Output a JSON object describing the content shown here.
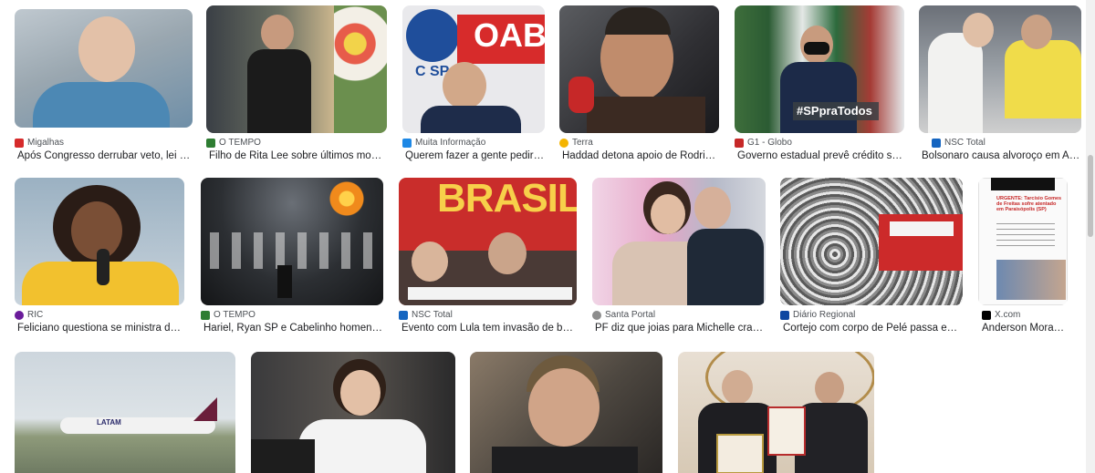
{
  "results": [
    {
      "source": "Migalhas",
      "title": "Após Congresso derrubar veto, lei P...",
      "fav_color": "#d62b2b"
    },
    {
      "source": "O TEMPO",
      "title": "Filho de Rita Lee sobre últimos mom...",
      "fav_color": "#2e7d32"
    },
    {
      "source": "Muita Informação",
      "title": "Querem fazer a gente pedir ...",
      "fav_color": "#1e88e5"
    },
    {
      "source": "Terra",
      "title": "Haddad detona apoio de Rodrig...",
      "fav_color": "#f4b400"
    },
    {
      "source": "G1 - Globo",
      "title": "Governo estadual prevê crédito su...",
      "fav_color": "#c62828"
    },
    {
      "source": "NSC Total",
      "title": "Bolsonaro causa alvoroço em Ap...",
      "fav_color": "#1565c0"
    },
    {
      "source": "RIC",
      "title": "Feliciano questiona se ministra da ...",
      "fav_color": "#6a1b9a"
    },
    {
      "source": "O TEMPO",
      "title": "Hariel, Ryan SP e Cabelinho homenag...",
      "fav_color": "#2e7d32"
    },
    {
      "source": "NSC Total",
      "title": "Evento com Lula tem invasão de bol...",
      "fav_color": "#1565c0"
    },
    {
      "source": "Santa Portal",
      "title": "PF diz que joias para Michelle crav...",
      "fav_color": "#8d8d8d"
    },
    {
      "source": "Diário Regional",
      "title": "Cortejo com corpo de Pelé passa em ...",
      "fav_color": "#0d47a1"
    },
    {
      "source": "X.com",
      "title": "Anderson Moraes o...",
      "fav_color": "#000000"
    }
  ],
  "overlays": {
    "oab": "OAB",
    "oab_sub": "C SP",
    "sp_tag": "#SPpraTodos",
    "brasil": "BRASIL",
    "latam": "LATAM",
    "tweet_head": "URGENTE: Tarcísio Gomes de Freitas sofre atentado em Paraisópolis (SP)"
  }
}
